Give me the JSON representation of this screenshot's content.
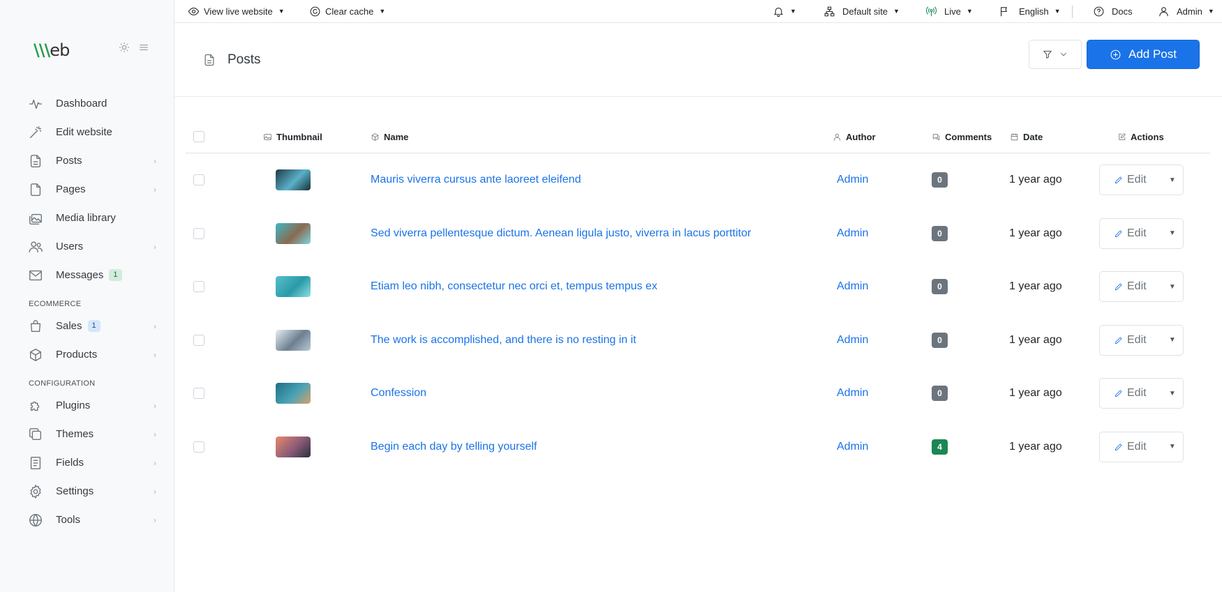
{
  "brand": {
    "logo_prefix": "\\\\\\",
    "logo_text": "eb"
  },
  "sidebar": {
    "items": [
      {
        "label": "Dashboard",
        "icon": "activity-icon",
        "chevron": false
      },
      {
        "label": "Edit website",
        "icon": "magic-wand-icon",
        "chevron": false
      },
      {
        "label": "Posts",
        "icon": "file-text-icon",
        "chevron": true
      },
      {
        "label": "Pages",
        "icon": "file-icon",
        "chevron": true
      },
      {
        "label": "Media library",
        "icon": "images-icon",
        "chevron": false
      },
      {
        "label": "Users",
        "icon": "users-icon",
        "chevron": true
      },
      {
        "label": "Messages",
        "icon": "mail-icon",
        "chevron": false,
        "badge": "1",
        "badge_color": "#d1ecdc",
        "badge_text_color": "#1f6b3b"
      }
    ],
    "section_ecommerce": "ECOMMERCE",
    "ecommerce_items": [
      {
        "label": "Sales",
        "icon": "shopping-bag-icon",
        "chevron": true,
        "badge": "1",
        "badge_color": "#d6e6fb",
        "badge_text_color": "#1a4f96"
      },
      {
        "label": "Products",
        "icon": "box-icon",
        "chevron": true
      }
    ],
    "section_configuration": "CONFIGURATION",
    "config_items": [
      {
        "label": "Plugins",
        "icon": "puzzle-icon",
        "chevron": true
      },
      {
        "label": "Themes",
        "icon": "layers-icon",
        "chevron": true
      },
      {
        "label": "Fields",
        "icon": "form-icon",
        "chevron": true
      },
      {
        "label": "Settings",
        "icon": "gear-icon",
        "chevron": true
      },
      {
        "label": "Tools",
        "icon": "globe-icon",
        "chevron": true
      }
    ]
  },
  "topbar": {
    "view_live": "View live website",
    "clear_cache": "Clear cache",
    "site": "Default site",
    "live": "Live",
    "language": "English",
    "docs": "Docs",
    "user": "Admin"
  },
  "page": {
    "title": "Posts",
    "add_button": "Add Post"
  },
  "table": {
    "headers": {
      "thumbnail": "Thumbnail",
      "name": "Name",
      "author": "Author",
      "comments": "Comments",
      "date": "Date",
      "actions": "Actions"
    },
    "edit_label": "Edit",
    "rows": [
      {
        "name": "Mauris viverra cursus ante laoreet eleifend",
        "author": "Admin",
        "comments": "0",
        "comments_color": "#6c757d",
        "date": "1 year ago",
        "thumb_colors": [
          "#1e3a48",
          "#5ab0c8",
          "#163038"
        ]
      },
      {
        "name": "Sed viverra pellentesque dictum. Aenean ligula justo, viverra in lacus porttitor",
        "author": "Admin",
        "comments": "0",
        "comments_color": "#6c757d",
        "date": "1 year ago",
        "thumb_colors": [
          "#3fb8c8",
          "#8a6a50",
          "#7fd4df"
        ]
      },
      {
        "name": "Etiam leo nibh, consectetur nec orci et, tempus tempus ex",
        "author": "Admin",
        "comments": "0",
        "comments_color": "#6c757d",
        "date": "1 year ago",
        "thumb_colors": [
          "#56c0c9",
          "#2a9aa8",
          "#8fe0e4"
        ]
      },
      {
        "name": "The work is accomplished, and there is no resting in it",
        "author": "Admin",
        "comments": "0",
        "comments_color": "#6c757d",
        "date": "1 year ago",
        "thumb_colors": [
          "#e8eef4",
          "#6d8090",
          "#b9c8d6"
        ]
      },
      {
        "name": "Confession",
        "author": "Admin",
        "comments": "0",
        "comments_color": "#6c757d",
        "date": "1 year ago",
        "thumb_colors": [
          "#1f6f86",
          "#4aa3b4",
          "#d9a06c"
        ]
      },
      {
        "name": "Begin each day by telling yourself",
        "author": "Admin",
        "comments": "4",
        "comments_color": "#198754",
        "date": "1 year ago",
        "thumb_colors": [
          "#e98a6a",
          "#8a5a78",
          "#2a2f3a"
        ]
      }
    ]
  }
}
